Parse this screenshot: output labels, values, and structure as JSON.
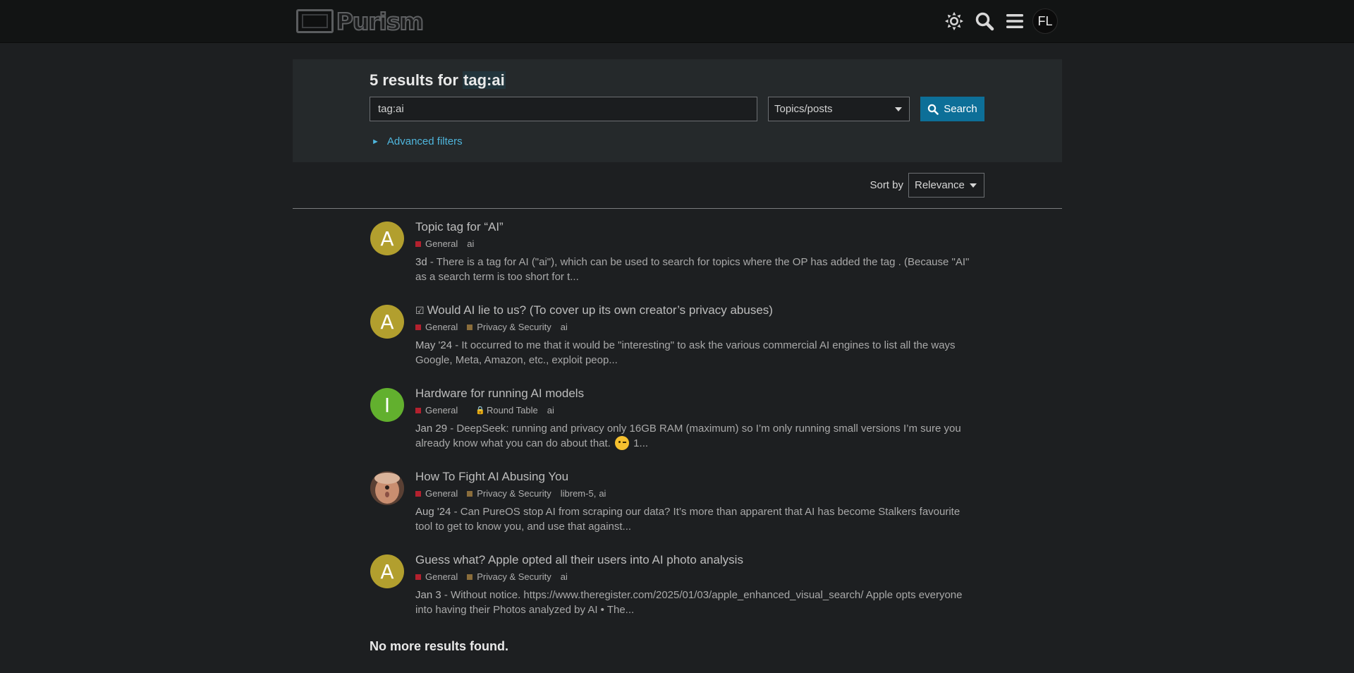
{
  "header": {
    "logo_text": "Purism",
    "icons": [
      "theme-toggle-icon",
      "search-icon",
      "hamburger-menu-icon"
    ],
    "user_initials": "FL"
  },
  "search": {
    "result_count_text": "5 results for ",
    "query_highlight": "tag:ai",
    "input_value": "tag:ai",
    "type_select_value": "Topics/posts",
    "search_button_label": "Search",
    "advanced_filters_label": "Advanced filters"
  },
  "sort": {
    "label": "Sort by",
    "value": "Relevance"
  },
  "results": [
    {
      "avatar_letter": "A",
      "avatar_color": "#b29f2e",
      "title": "Topic tag for “AI”",
      "solved": false,
      "categories": [
        {
          "name": "General",
          "color": "#b3212e"
        }
      ],
      "locked_category": "",
      "tags": [
        "ai"
      ],
      "date": "3d",
      "blurb": " - There is a tag for AI (\"ai\"), which can be used to search for topics where the OP has added the tag . (Because \"AI\" as a search term is too short for t...",
      "blurb_tail": ""
    },
    {
      "avatar_letter": "A",
      "avatar_color": "#b29f2e",
      "title": "Would AI lie to us? (To cover up its own creator’s privacy abuses)",
      "solved": true,
      "categories": [
        {
          "name": "General",
          "color": "#b3212e"
        },
        {
          "name": "Privacy & Security",
          "color": "#8a6d3b"
        }
      ],
      "locked_category": "",
      "tags": [
        "ai"
      ],
      "date": "May '24",
      "blurb": " - It occurred to me that it would be \"interesting\" to ask the various commercial AI engines to list all the ways Google, Meta, Amazon, etc., exploit peop...",
      "blurb_tail": ""
    },
    {
      "avatar_letter": "I",
      "avatar_color": "#62b02e",
      "title": "Hardware for running AI models",
      "solved": false,
      "categories": [
        {
          "name": "General",
          "color": "#b3212e"
        }
      ],
      "locked_category": "Round Table",
      "tags": [
        "ai"
      ],
      "date": "Jan 29",
      "blurb": " - DeepSeek: running and privacy only 16GB RAM (maximum) so I’m only running small versions I’m sure you already know what you can do about that. ",
      "blurb_tail": " 1..."
    },
    {
      "avatar_letter": "",
      "avatar_color": "#c98e70",
      "title": "How To Fight AI Abusing You",
      "solved": false,
      "categories": [
        {
          "name": "General",
          "color": "#b3212e"
        },
        {
          "name": "Privacy & Security",
          "color": "#8a6d3b"
        }
      ],
      "locked_category": "",
      "tags": [
        "librem-5",
        "ai"
      ],
      "date": "Aug '24",
      "blurb": " - Can PureOS stop AI from scraping our data? It’s more than apparent that AI has become Stalkers favourite tool to get to know you, and use that against...",
      "blurb_tail": ""
    },
    {
      "avatar_letter": "A",
      "avatar_color": "#b29f2e",
      "title": "Guess what? Apple opted all their users into AI photo analysis",
      "solved": false,
      "categories": [
        {
          "name": "General",
          "color": "#b3212e"
        },
        {
          "name": "Privacy & Security",
          "color": "#8a6d3b"
        }
      ],
      "locked_category": "",
      "tags": [
        "ai"
      ],
      "date": "Jan 3",
      "blurb": " - Without notice. https://www.theregister.com/2025/01/03/apple_enhanced_visual_search/ Apple opts everyone into having their Photos analyzed by AI • The...",
      "blurb_tail": ""
    }
  ],
  "footer_text": "No more results found."
}
